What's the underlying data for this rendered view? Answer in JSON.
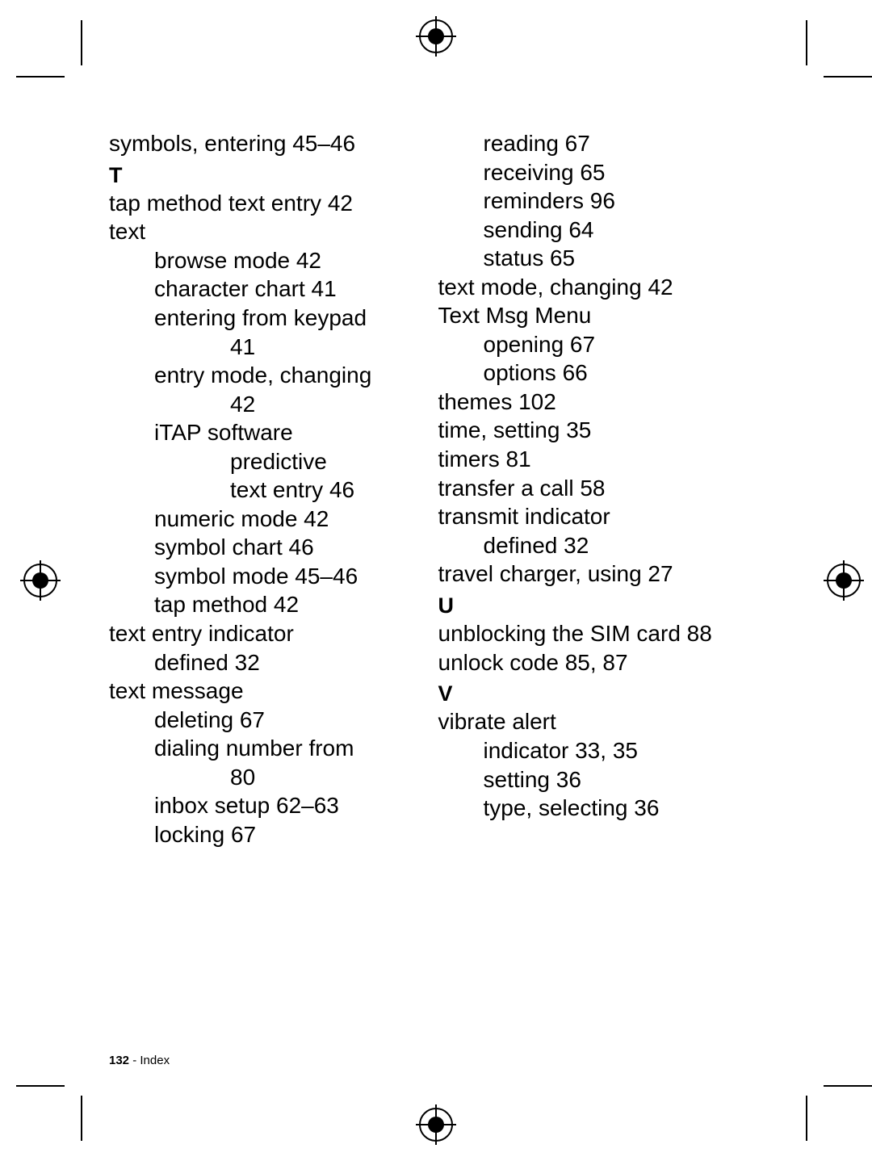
{
  "footer": {
    "page": "132",
    "sep": " - ",
    "label": "Index"
  },
  "left": {
    "e0": "symbols, entering 45–46",
    "secT": "T",
    "e1": "tap method text entry 42",
    "e2": "text",
    "e3": "browse mode 42",
    "e4": "character chart 41",
    "e5": "entering from keypad",
    "e5b": "41",
    "e6": "entry mode, changing",
    "e6b": "42",
    "e7": "iTAP software",
    "e7b": "predictive",
    "e7c": "text entry 46",
    "e8": "numeric mode 42",
    "e9": "symbol chart 46",
    "e10": "symbol mode 45–46",
    "e11": "tap method 42",
    "e12": "text entry indicator",
    "e13": "defined 32",
    "e14": "text message",
    "e15": "deleting 67",
    "e16": "dialing number from",
    "e16b": "80",
    "e17": "inbox setup 62–63",
    "e18": "locking 67"
  },
  "right": {
    "r1": "reading 67",
    "r2": "receiving 65",
    "r3": "reminders 96",
    "r4": "sending 64",
    "r5": "status 65",
    "r6": "text mode, changing 42",
    "r7": "Text Msg Menu",
    "r8": "opening 67",
    "r9": "options 66",
    "r10": "themes 102",
    "r11": "time, setting 35",
    "r12": "timers 81",
    "r13": "transfer a call 58",
    "r14": "transmit indicator",
    "r15": "defined 32",
    "r16": "travel charger, using 27",
    "secU": "U",
    "r17": "unblocking the SIM card 88",
    "r18": "unlock code 85, 87",
    "secV": "V",
    "r19": "vibrate alert",
    "r20": "indicator 33, 35",
    "r21": "setting 36",
    "r22": "type, selecting 36"
  }
}
